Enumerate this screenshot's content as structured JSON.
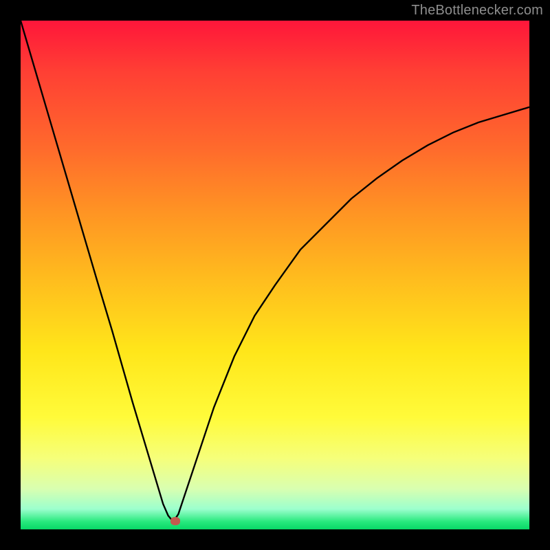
{
  "watermark": {
    "text": "TheBottlenecker.com"
  },
  "colors": {
    "frame_bg": "#000000",
    "marker": "#c35a4e",
    "curve_stroke": "#000000",
    "gradient_stops": [
      "#ff163a",
      "#ff3f34",
      "#ff6a2c",
      "#ff9523",
      "#ffba1e",
      "#ffe61a",
      "#fffb3a",
      "#f6ff7a",
      "#d9ffb0",
      "#9cffce",
      "#27e97d",
      "#08d867"
    ]
  },
  "chart_data": {
    "type": "line",
    "title": "",
    "xlabel": "",
    "ylabel": "",
    "xlim": [
      0,
      100
    ],
    "ylim": [
      0,
      100
    ],
    "grid": false,
    "legend": false,
    "marker": {
      "x_pct": 30.5,
      "y_pct": 1
    },
    "series": [
      {
        "name": "curve",
        "x": [
          0,
          5,
          10,
          15,
          18,
          22,
          25,
          28,
          29,
          30,
          31,
          34,
          38,
          42,
          46,
          50,
          55,
          60,
          65,
          70,
          75,
          80,
          85,
          90,
          95,
          100
        ],
        "y": [
          100,
          83,
          66,
          49,
          39,
          25,
          15,
          5,
          2.7,
          1.5,
          3,
          12,
          24,
          34,
          42,
          48,
          55,
          60,
          65,
          69,
          72.5,
          75.5,
          78,
          80,
          81.5,
          83
        ]
      }
    ]
  }
}
